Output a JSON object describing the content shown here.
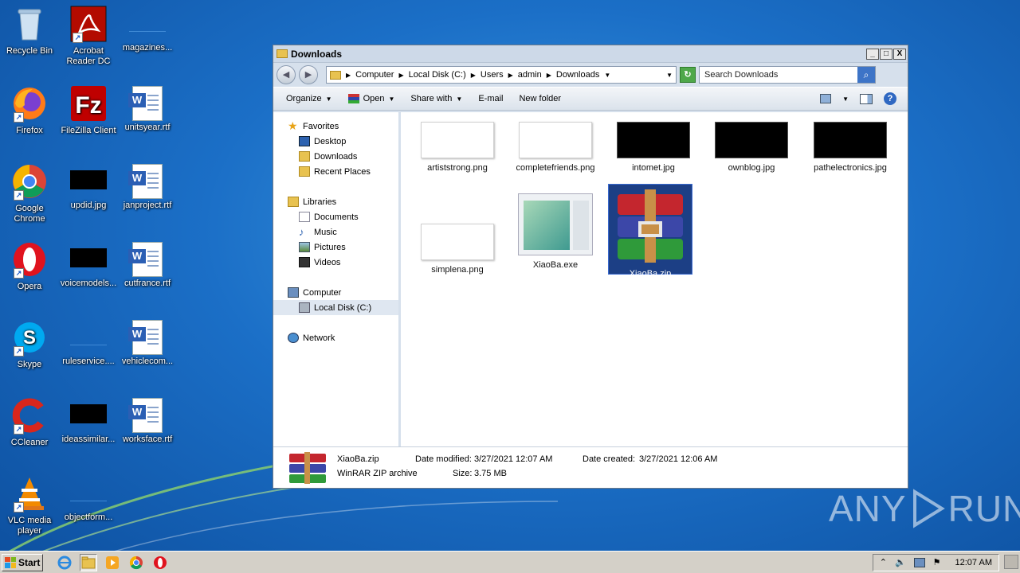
{
  "desktop": {
    "icons": [
      {
        "label": "Recycle Bin",
        "icon": "recycle-bin-icon"
      },
      {
        "label": "Acrobat Reader DC",
        "icon": "acrobat-icon"
      },
      {
        "label": "magazines...",
        "icon": "blank-file-icon"
      },
      {
        "label": "Firefox",
        "icon": "firefox-icon"
      },
      {
        "label": "FileZilla Client",
        "icon": "filezilla-icon"
      },
      {
        "label": "unitsyear.rtf",
        "icon": "word-doc-icon"
      },
      {
        "label": "Google Chrome",
        "icon": "chrome-icon"
      },
      {
        "label": "updid.jpg",
        "icon": "image-file-icon"
      },
      {
        "label": "janproject.rtf",
        "icon": "word-doc-icon"
      },
      {
        "label": "Opera",
        "icon": "opera-icon"
      },
      {
        "label": "voicemodels...",
        "icon": "image-file-icon"
      },
      {
        "label": "cutfrance.rtf",
        "icon": "word-doc-icon"
      },
      {
        "label": "Skype",
        "icon": "skype-icon"
      },
      {
        "label": "ruleservice....",
        "icon": "blank-file-icon"
      },
      {
        "label": "vehiclecom...",
        "icon": "word-doc-icon"
      },
      {
        "label": "CCleaner",
        "icon": "ccleaner-icon"
      },
      {
        "label": "ideassimilar...",
        "icon": "image-file-icon"
      },
      {
        "label": "worksface.rtf",
        "icon": "word-doc-icon"
      },
      {
        "label": "VLC media player",
        "icon": "vlc-icon"
      },
      {
        "label": "objectform...",
        "icon": "blank-file-icon"
      }
    ]
  },
  "window": {
    "title": "Downloads",
    "controls": {
      "minimize": "_",
      "maximize": "□",
      "close": "X"
    },
    "breadcrumb": [
      "Computer",
      "Local Disk (C:)",
      "Users",
      "admin",
      "Downloads"
    ],
    "search_placeholder": "Search Downloads",
    "toolbar": {
      "organize": "Organize",
      "open": "Open",
      "share_with": "Share with",
      "email": "E-mail",
      "new_folder": "New folder"
    },
    "nav": {
      "favorites": "Favorites",
      "desktop": "Desktop",
      "downloads": "Downloads",
      "recent": "Recent Places",
      "libraries": "Libraries",
      "documents": "Documents",
      "music": "Music",
      "pictures": "Pictures",
      "videos": "Videos",
      "computer": "Computer",
      "local_disk": "Local Disk (C:)",
      "network": "Network"
    },
    "files": [
      {
        "name": "artiststrong.png",
        "thumb": "white"
      },
      {
        "name": "completefriends.png",
        "thumb": "white"
      },
      {
        "name": "intomet.jpg",
        "thumb": "black"
      },
      {
        "name": "ownblog.jpg",
        "thumb": "black"
      },
      {
        "name": "pathelectronics.jpg",
        "thumb": "black"
      },
      {
        "name": "simplena.png",
        "thumb": "white"
      },
      {
        "name": "XiaoBa.exe",
        "thumb": "exe"
      },
      {
        "name": "XiaoBa.zip",
        "thumb": "rar",
        "selected": true
      }
    ],
    "details": {
      "name": "XiaoBa.zip",
      "type": "WinRAR ZIP archive",
      "modified_label": "Date modified:",
      "modified_value": "3/27/2021 12:07 AM",
      "created_label": "Date created:",
      "created_value": "3/27/2021 12:06 AM",
      "size_label": "Size:",
      "size_value": "3.75 MB"
    }
  },
  "taskbar": {
    "start_label": "Start",
    "clock": "12:07 AM"
  },
  "watermark": {
    "left": "ANY",
    "right": "RUN"
  },
  "colors": {
    "desktop_blue": "#1b6fc7",
    "selection": "#1c3f85",
    "taskbar": "#d4d0c8"
  }
}
